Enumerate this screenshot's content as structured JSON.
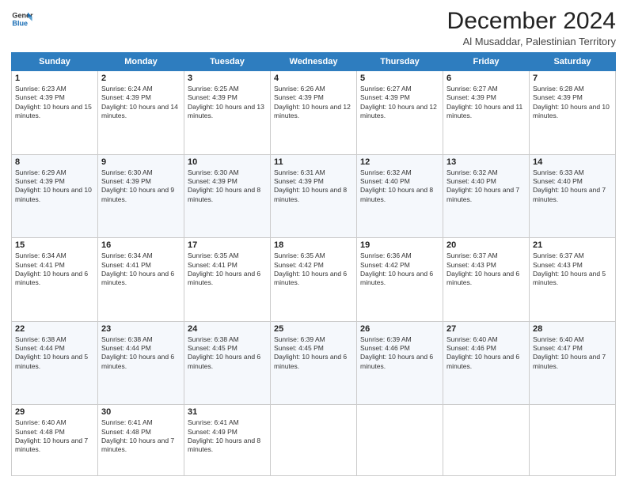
{
  "logo": {
    "line1": "General",
    "line2": "Blue"
  },
  "title": "December 2024",
  "subtitle": "Al Musaddar, Palestinian Territory",
  "days_of_week": [
    "Sunday",
    "Monday",
    "Tuesday",
    "Wednesday",
    "Thursday",
    "Friday",
    "Saturday"
  ],
  "weeks": [
    [
      {
        "day": "1",
        "info": "Sunrise: 6:23 AM\nSunset: 4:39 PM\nDaylight: 10 hours and 15 minutes."
      },
      {
        "day": "2",
        "info": "Sunrise: 6:24 AM\nSunset: 4:39 PM\nDaylight: 10 hours and 14 minutes."
      },
      {
        "day": "3",
        "info": "Sunrise: 6:25 AM\nSunset: 4:39 PM\nDaylight: 10 hours and 13 minutes."
      },
      {
        "day": "4",
        "info": "Sunrise: 6:26 AM\nSunset: 4:39 PM\nDaylight: 10 hours and 12 minutes."
      },
      {
        "day": "5",
        "info": "Sunrise: 6:27 AM\nSunset: 4:39 PM\nDaylight: 10 hours and 12 minutes."
      },
      {
        "day": "6",
        "info": "Sunrise: 6:27 AM\nSunset: 4:39 PM\nDaylight: 10 hours and 11 minutes."
      },
      {
        "day": "7",
        "info": "Sunrise: 6:28 AM\nSunset: 4:39 PM\nDaylight: 10 hours and 10 minutes."
      }
    ],
    [
      {
        "day": "8",
        "info": "Sunrise: 6:29 AM\nSunset: 4:39 PM\nDaylight: 10 hours and 10 minutes."
      },
      {
        "day": "9",
        "info": "Sunrise: 6:30 AM\nSunset: 4:39 PM\nDaylight: 10 hours and 9 minutes."
      },
      {
        "day": "10",
        "info": "Sunrise: 6:30 AM\nSunset: 4:39 PM\nDaylight: 10 hours and 8 minutes."
      },
      {
        "day": "11",
        "info": "Sunrise: 6:31 AM\nSunset: 4:39 PM\nDaylight: 10 hours and 8 minutes."
      },
      {
        "day": "12",
        "info": "Sunrise: 6:32 AM\nSunset: 4:40 PM\nDaylight: 10 hours and 8 minutes."
      },
      {
        "day": "13",
        "info": "Sunrise: 6:32 AM\nSunset: 4:40 PM\nDaylight: 10 hours and 7 minutes."
      },
      {
        "day": "14",
        "info": "Sunrise: 6:33 AM\nSunset: 4:40 PM\nDaylight: 10 hours and 7 minutes."
      }
    ],
    [
      {
        "day": "15",
        "info": "Sunrise: 6:34 AM\nSunset: 4:41 PM\nDaylight: 10 hours and 6 minutes."
      },
      {
        "day": "16",
        "info": "Sunrise: 6:34 AM\nSunset: 4:41 PM\nDaylight: 10 hours and 6 minutes."
      },
      {
        "day": "17",
        "info": "Sunrise: 6:35 AM\nSunset: 4:41 PM\nDaylight: 10 hours and 6 minutes."
      },
      {
        "day": "18",
        "info": "Sunrise: 6:35 AM\nSunset: 4:42 PM\nDaylight: 10 hours and 6 minutes."
      },
      {
        "day": "19",
        "info": "Sunrise: 6:36 AM\nSunset: 4:42 PM\nDaylight: 10 hours and 6 minutes."
      },
      {
        "day": "20",
        "info": "Sunrise: 6:37 AM\nSunset: 4:43 PM\nDaylight: 10 hours and 6 minutes."
      },
      {
        "day": "21",
        "info": "Sunrise: 6:37 AM\nSunset: 4:43 PM\nDaylight: 10 hours and 5 minutes."
      }
    ],
    [
      {
        "day": "22",
        "info": "Sunrise: 6:38 AM\nSunset: 4:44 PM\nDaylight: 10 hours and 5 minutes."
      },
      {
        "day": "23",
        "info": "Sunrise: 6:38 AM\nSunset: 4:44 PM\nDaylight: 10 hours and 6 minutes."
      },
      {
        "day": "24",
        "info": "Sunrise: 6:38 AM\nSunset: 4:45 PM\nDaylight: 10 hours and 6 minutes."
      },
      {
        "day": "25",
        "info": "Sunrise: 6:39 AM\nSunset: 4:45 PM\nDaylight: 10 hours and 6 minutes."
      },
      {
        "day": "26",
        "info": "Sunrise: 6:39 AM\nSunset: 4:46 PM\nDaylight: 10 hours and 6 minutes."
      },
      {
        "day": "27",
        "info": "Sunrise: 6:40 AM\nSunset: 4:46 PM\nDaylight: 10 hours and 6 minutes."
      },
      {
        "day": "28",
        "info": "Sunrise: 6:40 AM\nSunset: 4:47 PM\nDaylight: 10 hours and 7 minutes."
      }
    ],
    [
      {
        "day": "29",
        "info": "Sunrise: 6:40 AM\nSunset: 4:48 PM\nDaylight: 10 hours and 7 minutes."
      },
      {
        "day": "30",
        "info": "Sunrise: 6:41 AM\nSunset: 4:48 PM\nDaylight: 10 hours and 7 minutes."
      },
      {
        "day": "31",
        "info": "Sunrise: 6:41 AM\nSunset: 4:49 PM\nDaylight: 10 hours and 8 minutes."
      },
      {
        "day": "",
        "info": ""
      },
      {
        "day": "",
        "info": ""
      },
      {
        "day": "",
        "info": ""
      },
      {
        "day": "",
        "info": ""
      }
    ]
  ]
}
